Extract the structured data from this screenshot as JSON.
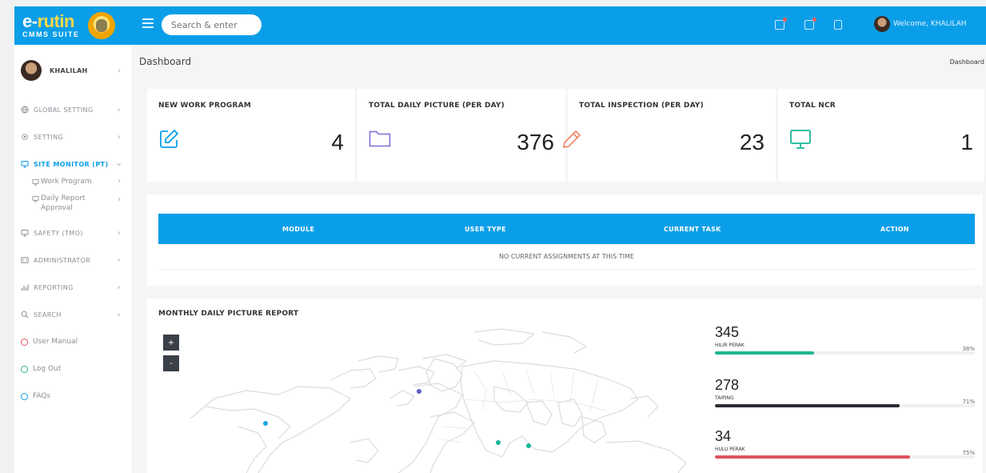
{
  "header": {
    "brand_main_a": "e-",
    "brand_main_b": "rutin",
    "brand_sub": "CMMS SUITE",
    "search_placeholder": "Search & enter",
    "welcome": "Welcome, KHALILAH",
    "color": "#0b9ee8"
  },
  "sidebar": {
    "user": "KHALILAH",
    "items": [
      {
        "label": "GLOBAL SETTING",
        "icon": "globe-icon"
      },
      {
        "label": "SETTING",
        "icon": "gear-icon"
      },
      {
        "label": "SITE MONITOR (PT)",
        "icon": "monitor-icon",
        "active": true
      },
      {
        "label": "SAFETY (TMO)",
        "icon": "monitor-icon"
      },
      {
        "label": "ADMINISTRATOR",
        "icon": "id-card-icon"
      },
      {
        "label": "REPORTING",
        "icon": "bar-chart-icon"
      },
      {
        "label": "SEARCH",
        "icon": "search-icon"
      }
    ],
    "sub_items": [
      "Work Program",
      "Daily Report Approval"
    ],
    "links": [
      {
        "label": "User Manual",
        "color": "#e0535d"
      },
      {
        "label": "Log Out",
        "color": "#2bb673"
      },
      {
        "label": "FAQs",
        "color": "#0b9ee8"
      }
    ]
  },
  "page": {
    "title": "Dashboard",
    "breadcrumb": "Dashboard"
  },
  "stats": [
    {
      "label": "NEW WORK PROGRAM",
      "value": "4",
      "icon": "edit-icon",
      "color": "#0b9ee8"
    },
    {
      "label": "TOTAL DAILY PICTURE (PER DAY)",
      "value": "376",
      "icon": "folder-icon",
      "color": "#8b7bd8"
    },
    {
      "label": "TOTAL INSPECTION (PER DAY)",
      "value": "23",
      "icon": "pencil-icon",
      "color": "#f08a6b"
    },
    {
      "label": "TOTAL NCR",
      "value": "1",
      "icon": "monitor-icon",
      "color": "#19b59b"
    }
  ],
  "assignments": {
    "columns": [
      "MODULE",
      "USER TYPE",
      "CURRENT TASK",
      "ACTION"
    ],
    "empty_text": "NO CURRENT ASSIGNMENTS AT THIS TIME"
  },
  "report": {
    "title": "MONTHLY DAILY PICTURE REPORT",
    "zoom_in": "+",
    "zoom_out": "-",
    "regions": [
      {
        "value": "345",
        "name": "HILIR PERAK",
        "pct_label": "38%",
        "fill": 0.38,
        "color": "#1fb58f"
      },
      {
        "value": "278",
        "name": "TAIPING",
        "pct_label": "71%",
        "fill": 0.71,
        "color": "#2a2d33"
      },
      {
        "value": "34",
        "name": "HULU PERAK",
        "pct_label": "75%",
        "fill": 0.75,
        "color": "#e0535d"
      }
    ]
  }
}
